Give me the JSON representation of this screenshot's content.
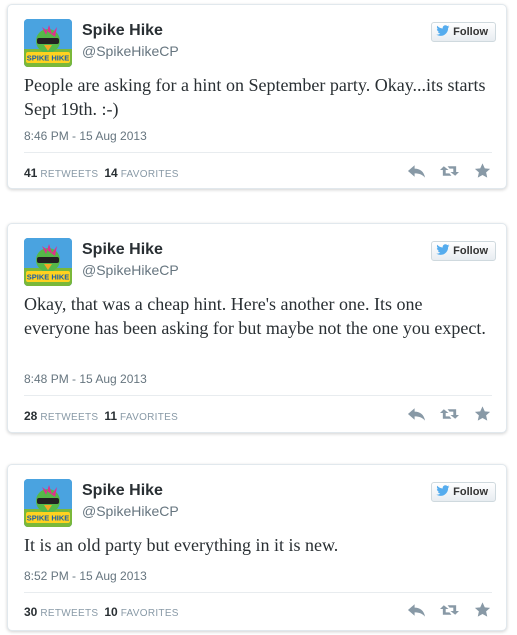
{
  "colors": {
    "text": "#292f33",
    "muted": "#66757f",
    "twitter_blue": "#55acee",
    "icon_gray": "#8899a6"
  },
  "tweets": [
    {
      "author_name": "Spike Hike",
      "author_handle": "@SpikeHikeCP",
      "follow_label": "Follow",
      "text": "People are asking for a hint on September party. Okay...its starts Sept 19th. :-)",
      "timestamp": "8:46 PM - 15 Aug 2013",
      "retweets_count": "41",
      "retweets_label": "RETWEETS",
      "favorites_count": "14",
      "favorites_label": "FAVORITES",
      "avatar_text": "SPIKE HIKE"
    },
    {
      "author_name": "Spike Hike",
      "author_handle": "@SpikeHikeCP",
      "follow_label": "Follow",
      "text": "Okay, that was a cheap hint. Here's another one. Its one everyone has been asking for but maybe not the one you expect.",
      "timestamp": "8:48 PM - 15 Aug 2013",
      "retweets_count": "28",
      "retweets_label": "RETWEETS",
      "favorites_count": "11",
      "favorites_label": "FAVORITES",
      "avatar_text": "SPIKE HIKE"
    },
    {
      "author_name": "Spike Hike",
      "author_handle": "@SpikeHikeCP",
      "follow_label": "Follow",
      "text": "It is an old party but everything in it is new.",
      "timestamp": "8:52 PM - 15 Aug 2013",
      "retweets_count": "30",
      "retweets_label": "RETWEETS",
      "favorites_count": "10",
      "favorites_label": "FAVORITES",
      "avatar_text": "SPIKE HIKE"
    }
  ],
  "icons": {
    "follow": "twitter-bird-icon",
    "reply": "reply-icon",
    "retweet": "retweet-icon",
    "favorite": "star-icon"
  }
}
